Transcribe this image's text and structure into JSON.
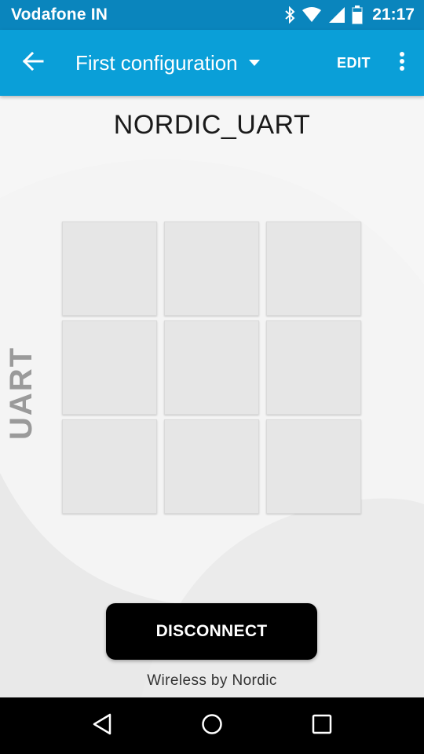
{
  "status_bar": {
    "carrier": "Vodafone IN",
    "time": "21:17",
    "icons": [
      "bluetooth-icon",
      "wifi-icon",
      "signal-icon",
      "battery-icon"
    ]
  },
  "toolbar": {
    "back_icon": "arrow-back-icon",
    "title": "First configuration",
    "dropdown_icon": "caret-down-icon",
    "edit_label": "EDIT",
    "more_icon": "more-vert-icon"
  },
  "main": {
    "device_name": "NORDIC_UART",
    "side_label": "UART",
    "grid_buttons": [
      "",
      "",
      "",
      "",
      "",
      "",
      "",
      "",
      ""
    ],
    "disconnect_label": "DISCONNECT",
    "footer": "Wireless by Nordic"
  },
  "nav_bar": {
    "back_icon": "nav-back-icon",
    "home_icon": "nav-home-icon",
    "recents_icon": "nav-recents-icon"
  },
  "colors": {
    "status_bar": "#0a85bd",
    "toolbar": "#0a9fd8",
    "disconnect_button": "#000000",
    "grid_cell": "#e6e6e6"
  }
}
